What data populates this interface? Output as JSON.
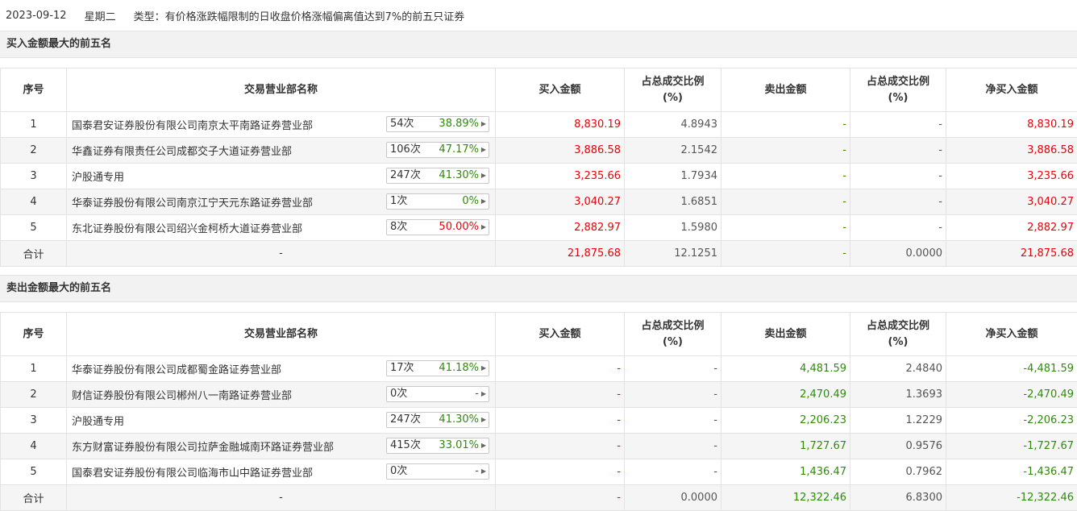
{
  "header": {
    "date": "2023-09-12",
    "weekday": "星期二",
    "type_label": "类型：",
    "type_text": "有价格涨跌幅限制的日收盘价格涨幅偏离值达到7%的前五只证券"
  },
  "columns": [
    "序号",
    "交易营业部名称",
    "买入金额",
    "占总成交比例\n(%)",
    "卖出金额",
    "占总成交比例\n(%)",
    "净买入金额"
  ],
  "colors": {
    "up": "#e4040c",
    "down": "#2e8b0b"
  },
  "buy_section": {
    "title": "买入金额最大的前五名",
    "rows": [
      {
        "idx": "1",
        "name": "国泰君安证券股份有限公司南京太平南路证券营业部",
        "count": "54次",
        "rate": "38.89%",
        "rate_color": "green",
        "buy": "8,830.19",
        "buy_pct": "4.8943",
        "sell": "-",
        "sell_pct": "-",
        "net": "8,830.19"
      },
      {
        "idx": "2",
        "name": "华鑫证券有限责任公司成都交子大道证券营业部",
        "count": "106次",
        "rate": "47.17%",
        "rate_color": "green",
        "buy": "3,886.58",
        "buy_pct": "2.1542",
        "sell": "-",
        "sell_pct": "-",
        "net": "3,886.58"
      },
      {
        "idx": "3",
        "name": "沪股通专用",
        "count": "247次",
        "rate": "41.30%",
        "rate_color": "green",
        "buy": "3,235.66",
        "buy_pct": "1.7934",
        "sell": "-",
        "sell_pct": "-",
        "net": "3,235.66"
      },
      {
        "idx": "4",
        "name": "华泰证券股份有限公司南京江宁天元东路证券营业部",
        "count": "1次",
        "rate": "0%",
        "rate_color": "green",
        "buy": "3,040.27",
        "buy_pct": "1.6851",
        "sell": "-",
        "sell_pct": "-",
        "net": "3,040.27"
      },
      {
        "idx": "5",
        "name": "东北证券股份有限公司绍兴金柯桥大道证券营业部",
        "count": "8次",
        "rate": "50.00%",
        "rate_color": "red",
        "buy": "2,882.97",
        "buy_pct": "1.5980",
        "sell": "-",
        "sell_pct": "-",
        "net": "2,882.97"
      }
    ],
    "total": {
      "label": "合计",
      "name": "-",
      "buy": "21,875.68",
      "buy_pct": "12.1251",
      "sell": "-",
      "sell_pct": "0.0000",
      "net": "21,875.68"
    }
  },
  "sell_section": {
    "title": "卖出金额最大的前五名",
    "rows": [
      {
        "idx": "1",
        "name": "华泰证券股份有限公司成都蜀金路证券营业部",
        "count": "17次",
        "rate": "41.18%",
        "rate_color": "green",
        "buy": "-",
        "buy_pct": "-",
        "sell": "4,481.59",
        "sell_pct": "2.4840",
        "net": "-4,481.59"
      },
      {
        "idx": "2",
        "name": "财信证券股份有限公司郴州八一南路证券营业部",
        "count": "0次",
        "rate": "-",
        "rate_color": "gray",
        "buy": "-",
        "buy_pct": "-",
        "sell": "2,470.49",
        "sell_pct": "1.3693",
        "net": "-2,470.49"
      },
      {
        "idx": "3",
        "name": "沪股通专用",
        "count": "247次",
        "rate": "41.30%",
        "rate_color": "green",
        "buy": "-",
        "buy_pct": "-",
        "sell": "2,206.23",
        "sell_pct": "1.2229",
        "net": "-2,206.23"
      },
      {
        "idx": "4",
        "name": "东方财富证券股份有限公司拉萨金融城南环路证券营业部",
        "count": "415次",
        "rate": "33.01%",
        "rate_color": "green",
        "buy": "-",
        "buy_pct": "-",
        "sell": "1,727.67",
        "sell_pct": "0.9576",
        "net": "-1,727.67"
      },
      {
        "idx": "5",
        "name": "国泰君安证券股份有限公司临海市山中路证券营业部",
        "count": "0次",
        "rate": "-",
        "rate_color": "gray",
        "buy": "-",
        "buy_pct": "-",
        "sell": "1,436.47",
        "sell_pct": "0.7962",
        "net": "-1,436.47"
      }
    ],
    "total": {
      "label": "合计",
      "name": "-",
      "buy": "-",
      "buy_pct": "0.0000",
      "sell": "12,322.46",
      "sell_pct": "6.8300",
      "net": "-12,322.46"
    }
  }
}
